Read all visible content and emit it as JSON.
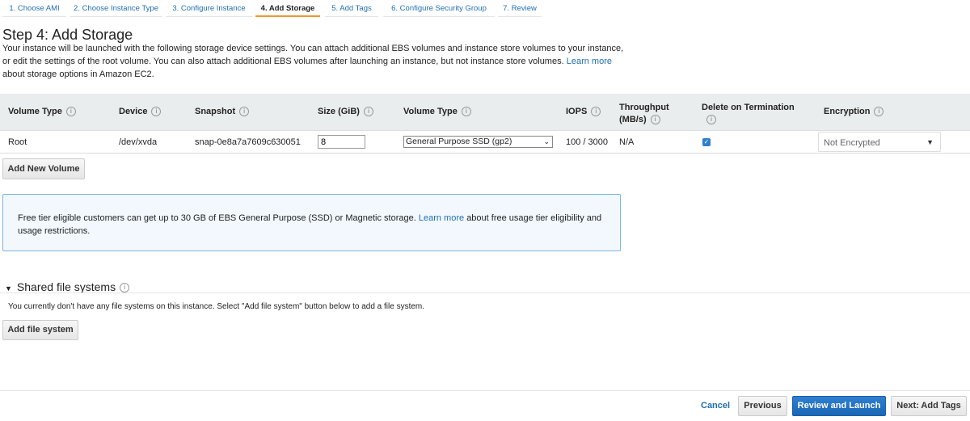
{
  "wizard": {
    "tabs": [
      "1. Choose AMI",
      "2. Choose Instance Type",
      "3. Configure Instance",
      "4. Add Storage",
      "5. Add Tags",
      "6. Configure Security Group",
      "7. Review"
    ],
    "active": 3
  },
  "page": {
    "title": "Step 4: Add Storage",
    "description": "Your instance will be launched with the following storage device settings. You can attach additional EBS volumes and instance store volumes to your instance, or edit the settings of the root volume. You can also attach additional EBS volumes after launching an instance, but not instance store volumes.",
    "learn_more": "Learn more",
    "description_tail": "about storage options in Amazon EC2."
  },
  "table": {
    "headers": [
      "Volume Type",
      "Device",
      "Snapshot",
      "Size (GiB)",
      "Volume Type",
      "IOPS",
      "Throughput (MB/s)",
      "Delete on Termination",
      "Encryption"
    ],
    "row": {
      "volume_type": "Root",
      "device": "/dev/xvda",
      "snapshot": "snap-0e8a7a7609c630051",
      "size": "8",
      "ebs_type": "General Purpose SSD (gp2)",
      "iops": "100 / 3000",
      "throughput": "N/A",
      "delete_on_termination": true,
      "encryption": "Not Encrypted"
    }
  },
  "add_volume": "Add New Volume",
  "free_tier": {
    "text": "Free tier eligible customers can get up to 30 GB of EBS General Purpose (SSD) or Magnetic storage.",
    "link": "Learn more",
    "tail": "about free usage tier eligibility and usage restrictions."
  },
  "shared_fs": {
    "title": "Shared file systems",
    "text": "You currently don't have any file systems on this instance. Select \"Add file system\" button below to add a file system.",
    "button": "Add file system"
  },
  "footer": {
    "cancel": "Cancel",
    "previous": "Previous",
    "review": "Review and Launch",
    "next": "Next: Add Tags"
  }
}
